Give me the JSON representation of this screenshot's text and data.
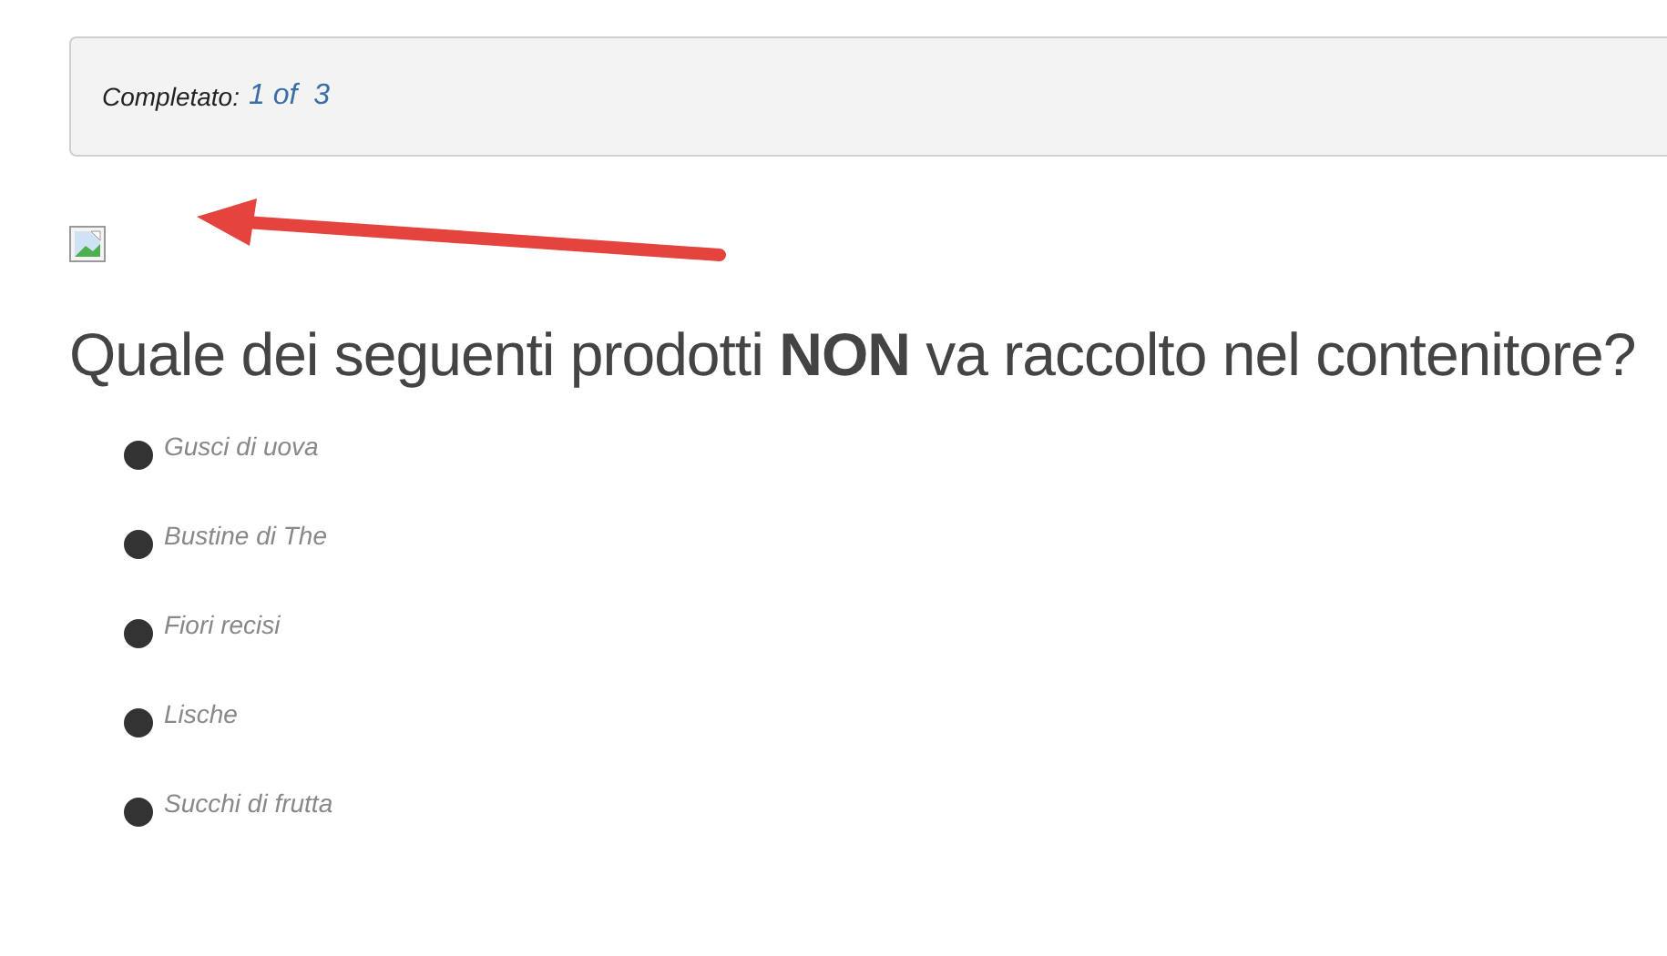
{
  "progress": {
    "label": "Completato:",
    "value": "1 of  3"
  },
  "question": "Quale dei seguenti prodotti **NON** va raccolto nel contenitore?",
  "options": [
    {
      "label": "Gusci di uova"
    },
    {
      "label": "Bustine di The"
    },
    {
      "label": "Fiori recisi"
    },
    {
      "label": "Lische"
    },
    {
      "label": "Succhi di frutta"
    }
  ]
}
